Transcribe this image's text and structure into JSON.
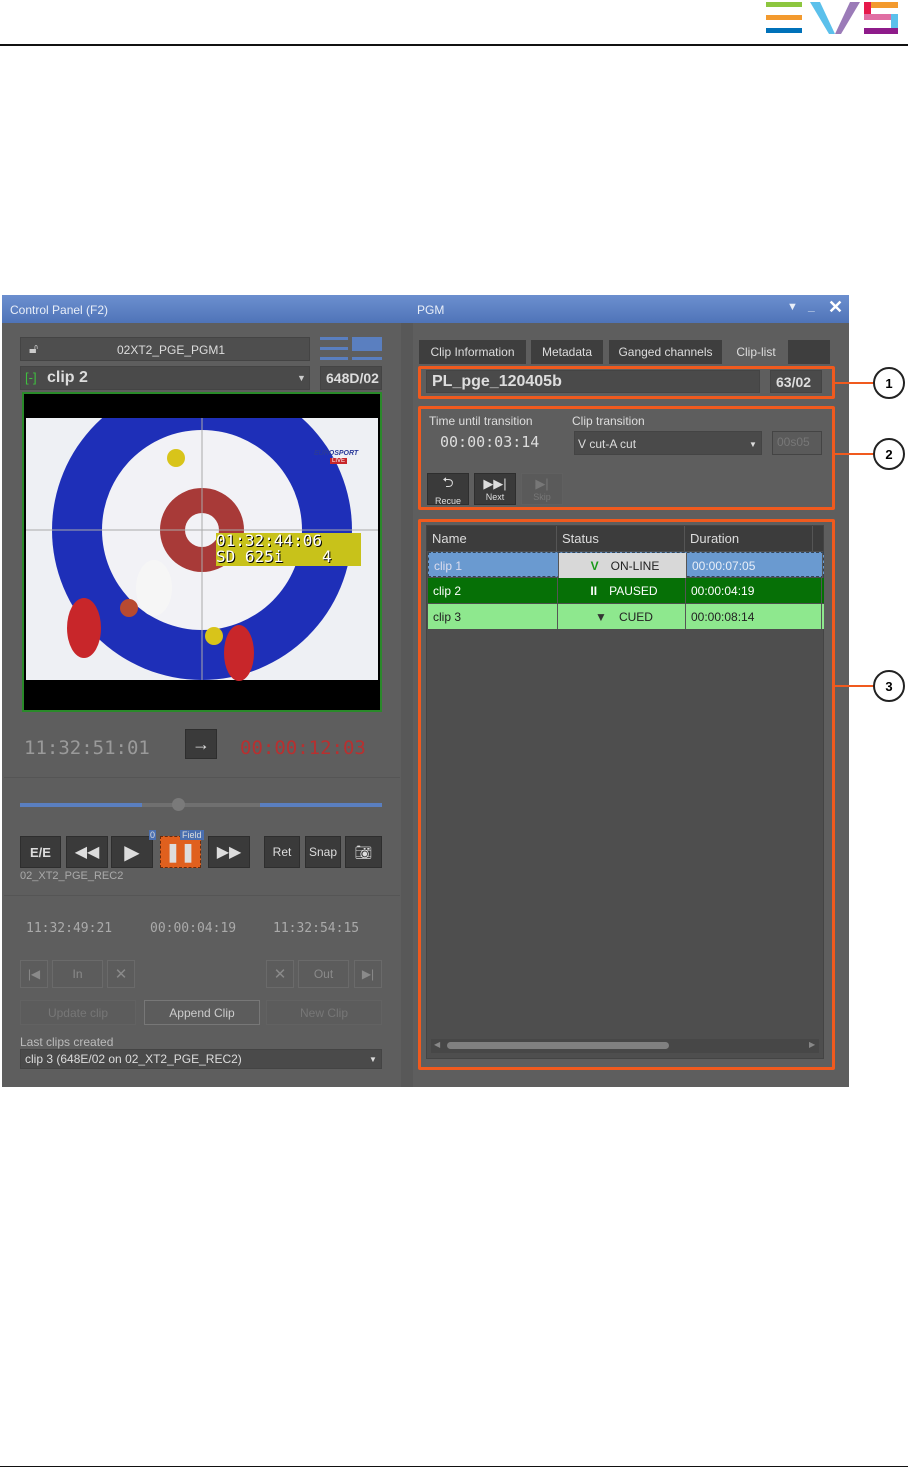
{
  "logo": {
    "text": "EVS",
    "colors": [
      "#8dc63f",
      "#f39a2e",
      "#0071b9",
      "#5bc0eb",
      "#9b7bb8",
      "#e6194b",
      "#e06ea3",
      "#8e1b8a"
    ]
  },
  "window": {
    "left_title": "Control Panel (F2)",
    "right_title": "PGM",
    "icons": [
      "dropdown-icon",
      "minimize-icon",
      "close-icon"
    ]
  },
  "left": {
    "channel": "02XT2_PGE_PGM1",
    "clip_name": "clip 2",
    "clip_id": "648D/02",
    "video_overlay": {
      "line1": "01:32:44:06",
      "line2": "SD 625i    4",
      "broadcaster": "EUROSPORT",
      "live": "LIVE"
    },
    "timecode": "11:32:51:01",
    "remaining": "00:00:12:03",
    "slider_position": 0.44,
    "transport": {
      "ee": "E/E",
      "ret": "Ret",
      "snap": "Snap",
      "field_badge": "Field",
      "zero_badge": "0"
    },
    "recorder": "02_XT2_PGE_REC2",
    "in_tc": "11:32:49:21",
    "duration_tc": "00:00:04:19",
    "out_tc": "11:32:54:15",
    "in_label": "In",
    "out_label": "Out",
    "update_clip": "Update clip",
    "append_clip": "Append Clip",
    "new_clip": "New Clip",
    "last_clips_label": "Last clips created",
    "last_clip_value": "clip 3 (648E/02 on 02_XT2_PGE_REC2)"
  },
  "right": {
    "tabs": [
      "Clip Information",
      "Metadata",
      "Ganged channels",
      "Clip-list"
    ],
    "playlist_name": "PL_pge_120405b",
    "playlist_id": "63/02",
    "time_until_label": "Time until transition",
    "time_until": "00:00:03:14",
    "clip_transition_label": "Clip transition",
    "clip_transition": "V cut-A cut",
    "transition_duration": "00s05",
    "recue": "Recue",
    "next": "Next",
    "skip": "Skip",
    "columns": [
      "Name",
      "Status",
      "Duration"
    ],
    "rows": [
      {
        "name": "clip 1",
        "icon": "V",
        "status": "ON-LINE",
        "duration": "00:00:07:05"
      },
      {
        "name": "clip 2",
        "icon": "II",
        "status": "PAUSED",
        "duration": "00:00:04:19"
      },
      {
        "name": "clip 3",
        "icon": "▼",
        "status": "CUED",
        "duration": "00:00:08:14"
      }
    ]
  },
  "callouts": [
    "1",
    "2",
    "3"
  ]
}
